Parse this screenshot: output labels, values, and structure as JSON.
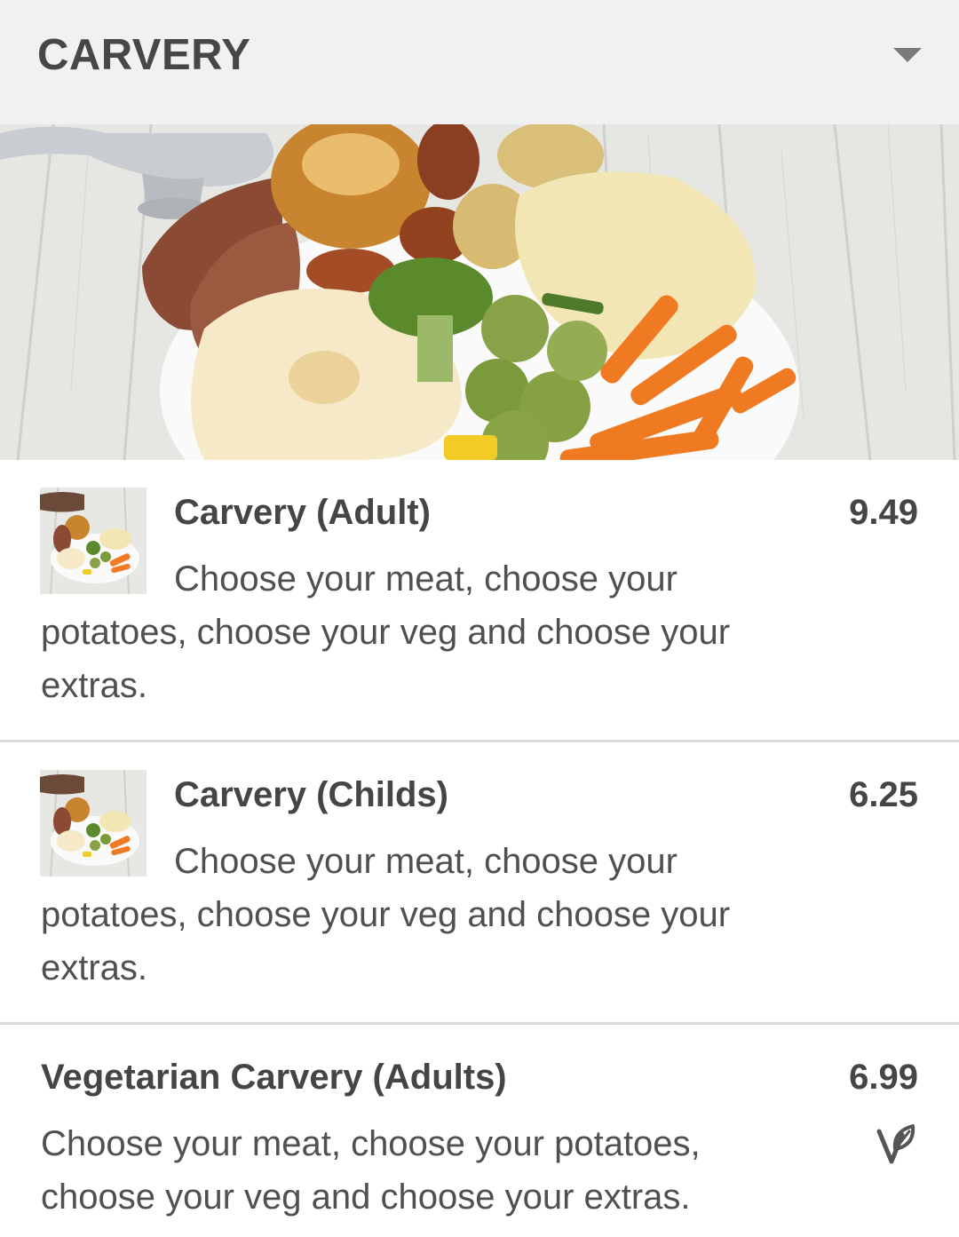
{
  "section": {
    "title": "CARVERY"
  },
  "items": [
    {
      "title": "Carvery (Adult)",
      "price": "9.49",
      "description": "Choose your meat, choose your potatoes, choose your veg and choose your extras."
    },
    {
      "title": "Carvery (Childs)",
      "price": "6.25",
      "description": "Choose your meat, choose your potatoes, choose your veg and choose your extras."
    },
    {
      "title": "Vegetarian Carvery (Adults)",
      "price": "6.99",
      "description": "Choose your meat, choose your potatoes, choose your veg and choose your extras."
    }
  ],
  "icons": {
    "dropdown": "chevron-down-icon",
    "vegetarian": "vegetarian-icon"
  },
  "colors": {
    "header_bg": "#f1f1f1",
    "text": "#454545",
    "divider": "#d9d9d9"
  }
}
